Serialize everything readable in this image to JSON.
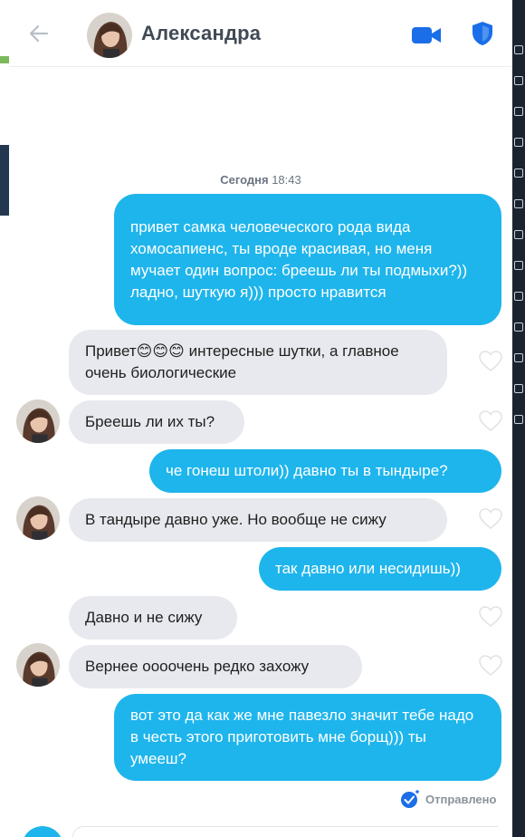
{
  "header": {
    "contact_name": "Александра",
    "avatar_label": "avatar-aleksandra",
    "back_icon": "arrow-left-icon",
    "video_icon": "video-camera-icon",
    "shield_icon": "shield-icon"
  },
  "chat": {
    "timestamp_day": "Сегодня",
    "timestamp_time": "18:43",
    "messages": [
      {
        "side": "out",
        "text": "привет самка человеческого рода вида хомосапиенс, ты вроде красивая, но меня мучает один вопрос: бреешь ли ты подмыхи?)) ладно, шуткую я))) просто нравится"
      },
      {
        "side": "in",
        "text": "Привет😊😊😊 интересные шутки, а главное очень биологические"
      },
      {
        "side": "in",
        "text": "Бреешь ли их ты?"
      },
      {
        "side": "out",
        "text": "че гонеш штоли)) давно ты в тындыре?"
      },
      {
        "side": "in",
        "text": "В тандыре давно уже. Но вообще не сижу"
      },
      {
        "side": "out",
        "text": "так давно или несидишь))"
      },
      {
        "side": "in",
        "text": "Давно и не сижу"
      },
      {
        "side": "in",
        "text": "Вернее оооочень редко захожу"
      },
      {
        "side": "out",
        "text": "вот это да как же мне павезло значит тебе надо в честь этого приготовить мне борщ))) ты умееш?"
      }
    ],
    "sent_status": "Отправлено"
  },
  "colors": {
    "outgoing_bubble": "#1eb5ec",
    "incoming_bubble": "#e8e9ee",
    "brand_blue": "#1a6ee8"
  }
}
